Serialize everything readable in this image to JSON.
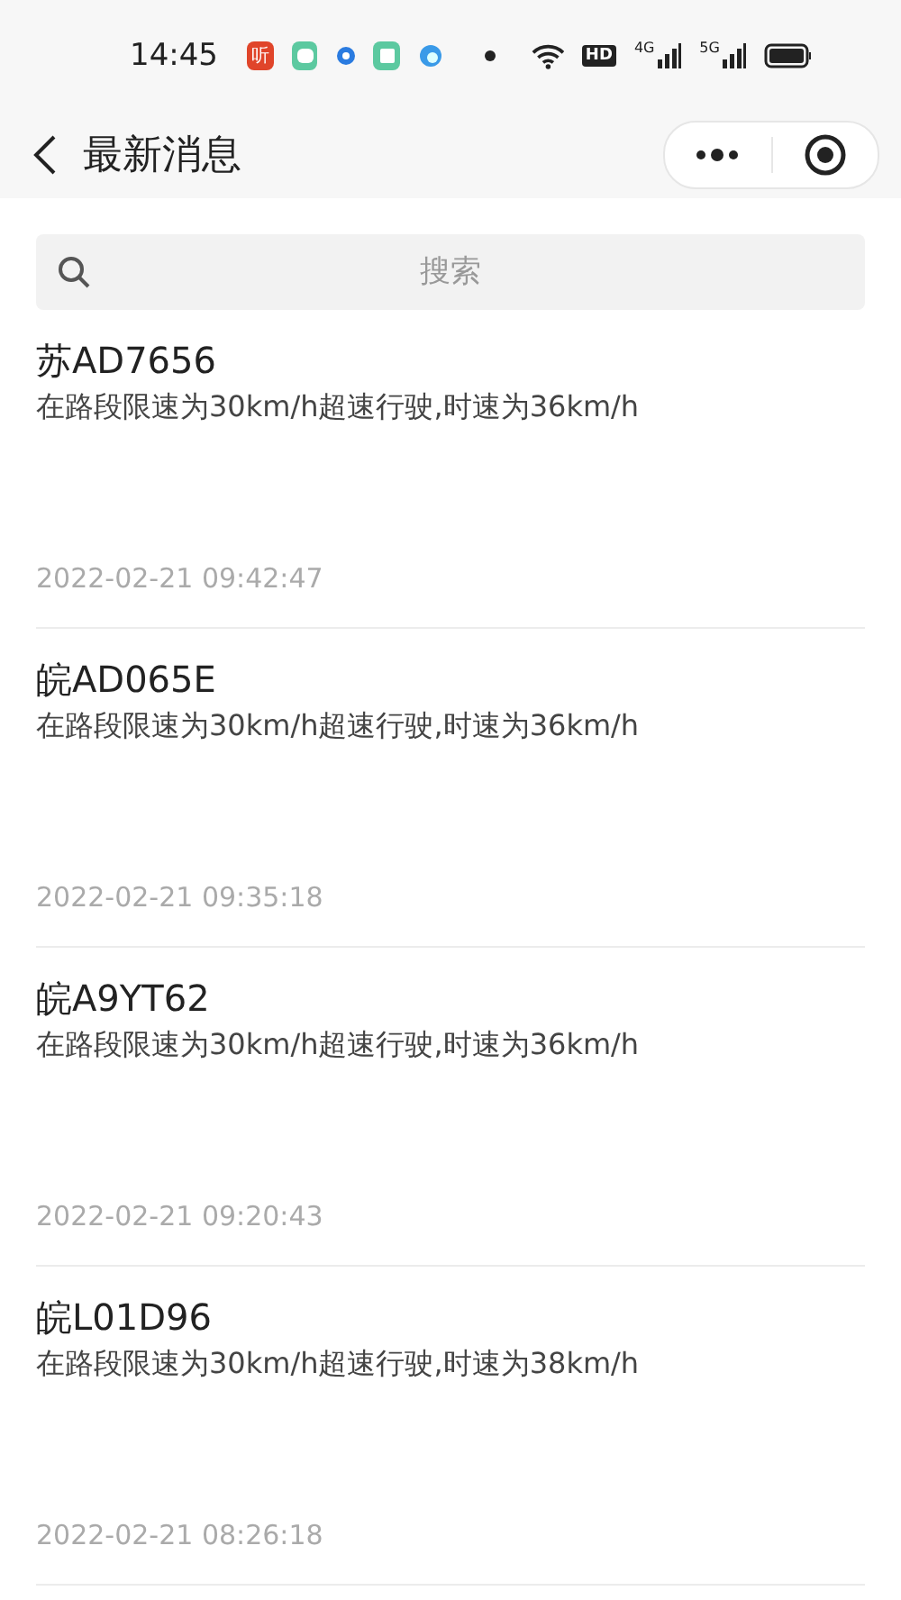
{
  "status_bar": {
    "time": "14:45",
    "app_badge": "听",
    "hd": "HD",
    "network_1": "4G",
    "network_2": "5G"
  },
  "header": {
    "title": "最新消息"
  },
  "search": {
    "placeholder": "搜索"
  },
  "messages": [
    {
      "plate": "苏AD7656",
      "text": "在路段限速为30km/h超速行驶,时速为36km/h",
      "time": "2022-02-21 09:42:47"
    },
    {
      "plate": "皖AD065E",
      "text": "在路段限速为30km/h超速行驶,时速为36km/h",
      "time": "2022-02-21 09:35:18"
    },
    {
      "plate": "皖A9YT62",
      "text": "在路段限速为30km/h超速行驶,时速为36km/h",
      "time": "2022-02-21 09:20:43"
    },
    {
      "plate": "皖L01D96",
      "text": "在路段限速为30km/h超速行驶,时速为38km/h",
      "time": "2022-02-21 08:26:18"
    }
  ]
}
